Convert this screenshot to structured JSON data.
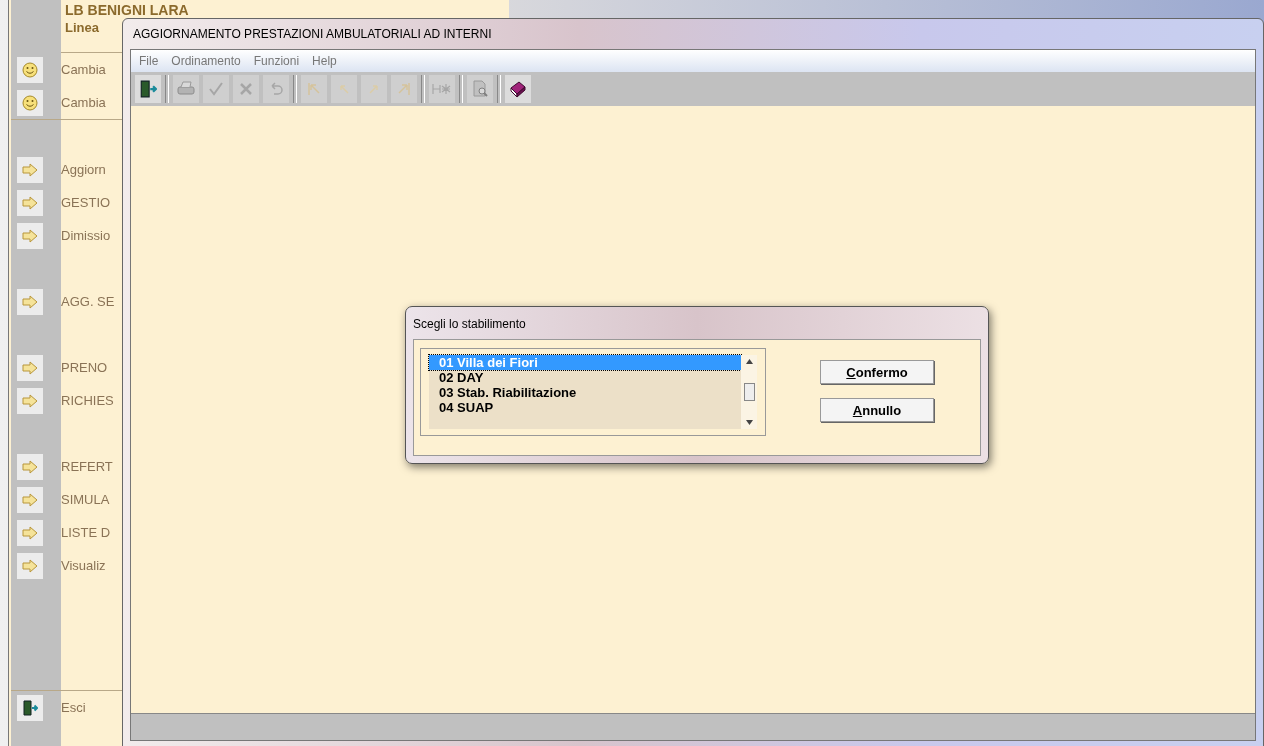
{
  "background_app": {
    "user_name": "LB BENIGNI LARA",
    "subtitle": "Linea",
    "groups": [
      {
        "items": [
          {
            "kind": "smiley",
            "label": "Cambia"
          },
          {
            "kind": "smiley",
            "label": "Cambia"
          }
        ]
      },
      {
        "items": [
          {
            "kind": "arrow",
            "label": "Aggiorn"
          },
          {
            "kind": "arrow",
            "label": "GESTIO"
          },
          {
            "kind": "arrow",
            "label": "Dimissio"
          }
        ]
      },
      {
        "items": [
          {
            "kind": "arrow",
            "label": "AGG. SE"
          }
        ]
      },
      {
        "items": [
          {
            "kind": "arrow",
            "label": "PRENO"
          },
          {
            "kind": "arrow",
            "label": "RICHIES"
          }
        ]
      },
      {
        "items": [
          {
            "kind": "arrow",
            "label": "REFERT"
          },
          {
            "kind": "arrow",
            "label": "SIMULA"
          },
          {
            "kind": "arrow",
            "label": "LISTE D"
          },
          {
            "kind": "arrow",
            "label": "Visualiz"
          }
        ]
      }
    ],
    "exit_item": {
      "kind": "exit",
      "label": "Esci"
    }
  },
  "window": {
    "title": "AGGIORNAMENTO PRESTAZIONI AMBULATORIALI AD INTERNI",
    "menu": [
      "File",
      "Ordinamento",
      "Funzioni",
      "Help"
    ],
    "toolbar_groups": [
      [
        {
          "kind": "exit",
          "disabled": false
        }
      ],
      [
        {
          "kind": "print",
          "disabled": true
        },
        {
          "kind": "check",
          "disabled": true
        },
        {
          "kind": "cross",
          "disabled": true
        },
        {
          "kind": "undo",
          "disabled": true
        }
      ],
      [
        {
          "kind": "first",
          "disabled": true
        },
        {
          "kind": "prev",
          "disabled": true
        },
        {
          "kind": "next",
          "disabled": true
        },
        {
          "kind": "last",
          "disabled": true
        }
      ],
      [
        {
          "kind": "new",
          "disabled": true
        }
      ],
      [
        {
          "kind": "preview",
          "disabled": true
        }
      ],
      [
        {
          "kind": "book",
          "disabled": false
        }
      ]
    ]
  },
  "dialog": {
    "title": "Scegli lo stabilimento",
    "items": [
      {
        "label": "01  Villa dei Fiori",
        "selected": true
      },
      {
        "label": "02  DAY",
        "selected": false
      },
      {
        "label": "03  Stab. Riabilitazione",
        "selected": false
      },
      {
        "label": "04  SUAP",
        "selected": false
      }
    ],
    "buttons": [
      "Confermo",
      "Annullo"
    ]
  }
}
